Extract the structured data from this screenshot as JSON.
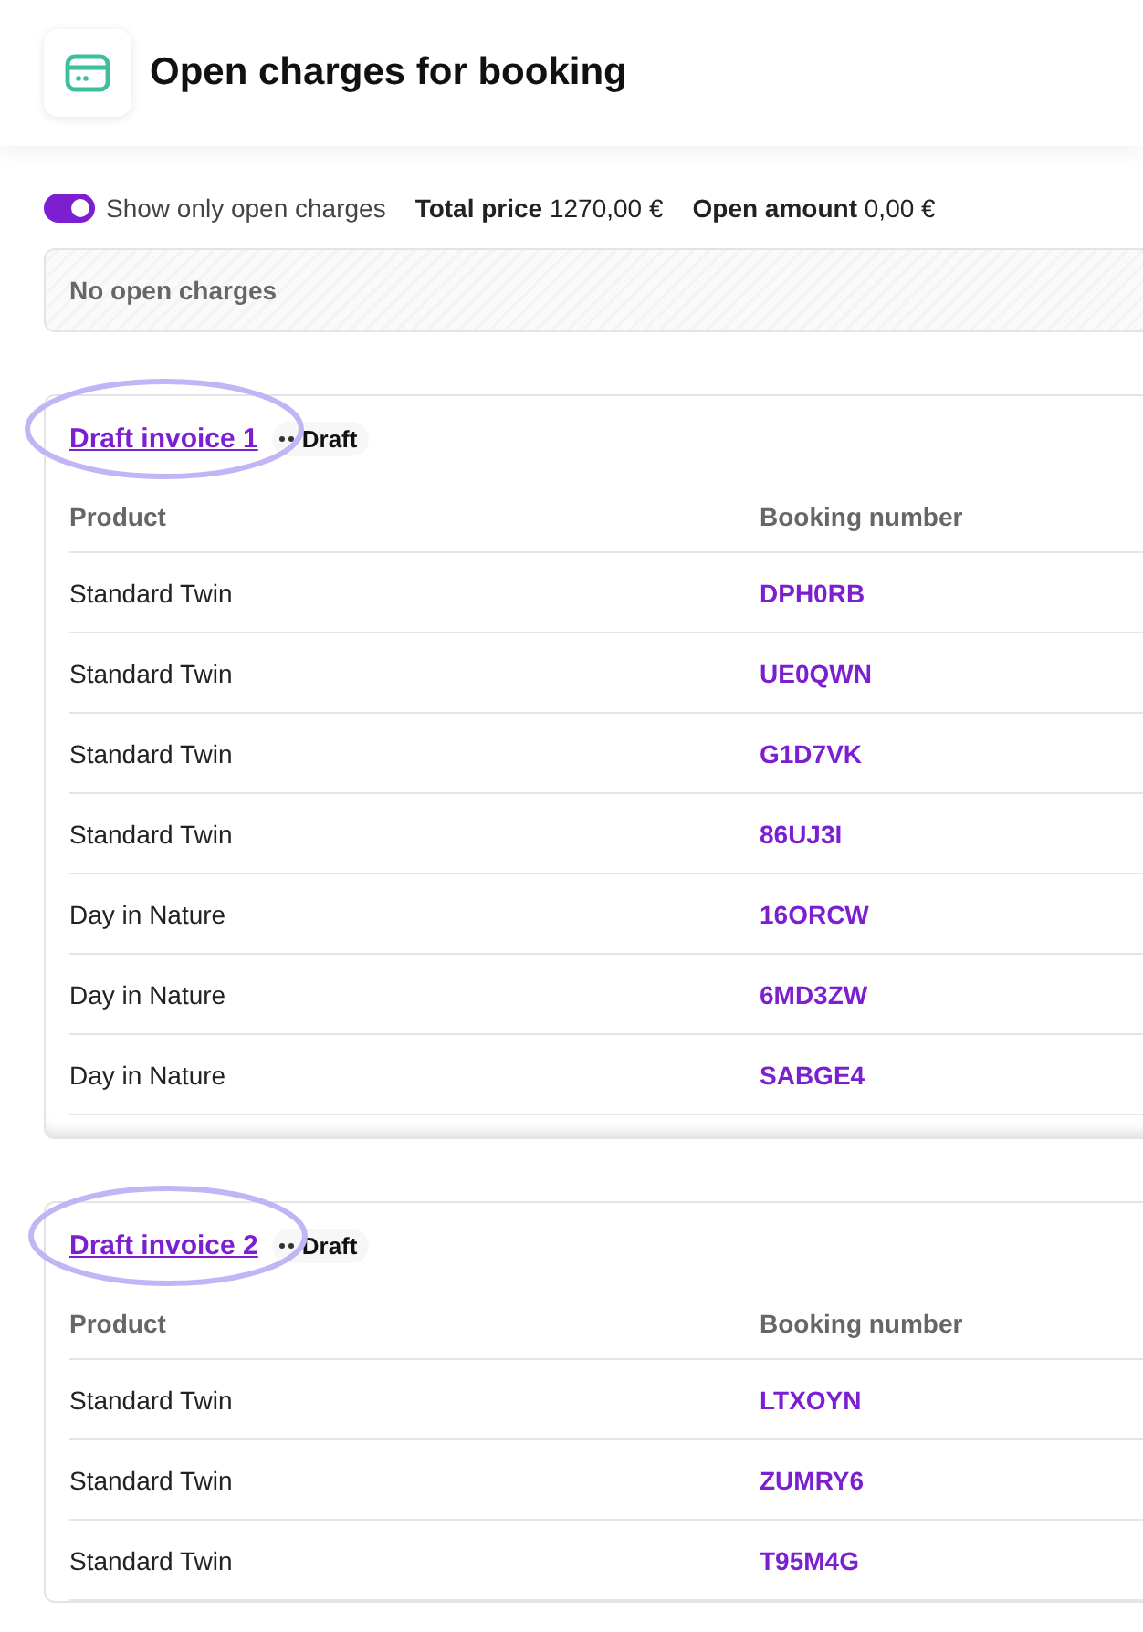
{
  "header": {
    "title": "Open charges for booking"
  },
  "toolbar": {
    "toggle": {
      "label": "Show only open charges",
      "on": true
    },
    "totals": [
      {
        "label": "Total price",
        "value": "1270,00 €"
      },
      {
        "label": "Open amount",
        "value": "0,00 €"
      }
    ]
  },
  "empty_notice": "No open charges",
  "invoices": [
    {
      "title": "Draft invoice 1",
      "status": "Draft",
      "highlighted": true,
      "columns": [
        "Product",
        "Booking number"
      ],
      "rows": [
        [
          "Standard Twin",
          "DPH0RB"
        ],
        [
          "Standard Twin",
          "UE0QWN"
        ],
        [
          "Standard Twin",
          "G1D7VK"
        ],
        [
          "Standard Twin",
          "86UJ3I"
        ],
        [
          "Day in Nature",
          "16ORCW"
        ],
        [
          "Day in Nature",
          "6MD3ZW"
        ],
        [
          "Day in Nature",
          "SABGE4"
        ]
      ]
    },
    {
      "title": "Draft invoice 2",
      "status": "Draft",
      "highlighted": true,
      "columns": [
        "Product",
        "Booking number"
      ],
      "rows": [
        [
          "Standard Twin",
          "LTXOYN"
        ],
        [
          "Standard Twin",
          "ZUMRY6"
        ],
        [
          "Standard Twin",
          "T95M4G"
        ]
      ]
    }
  ]
}
